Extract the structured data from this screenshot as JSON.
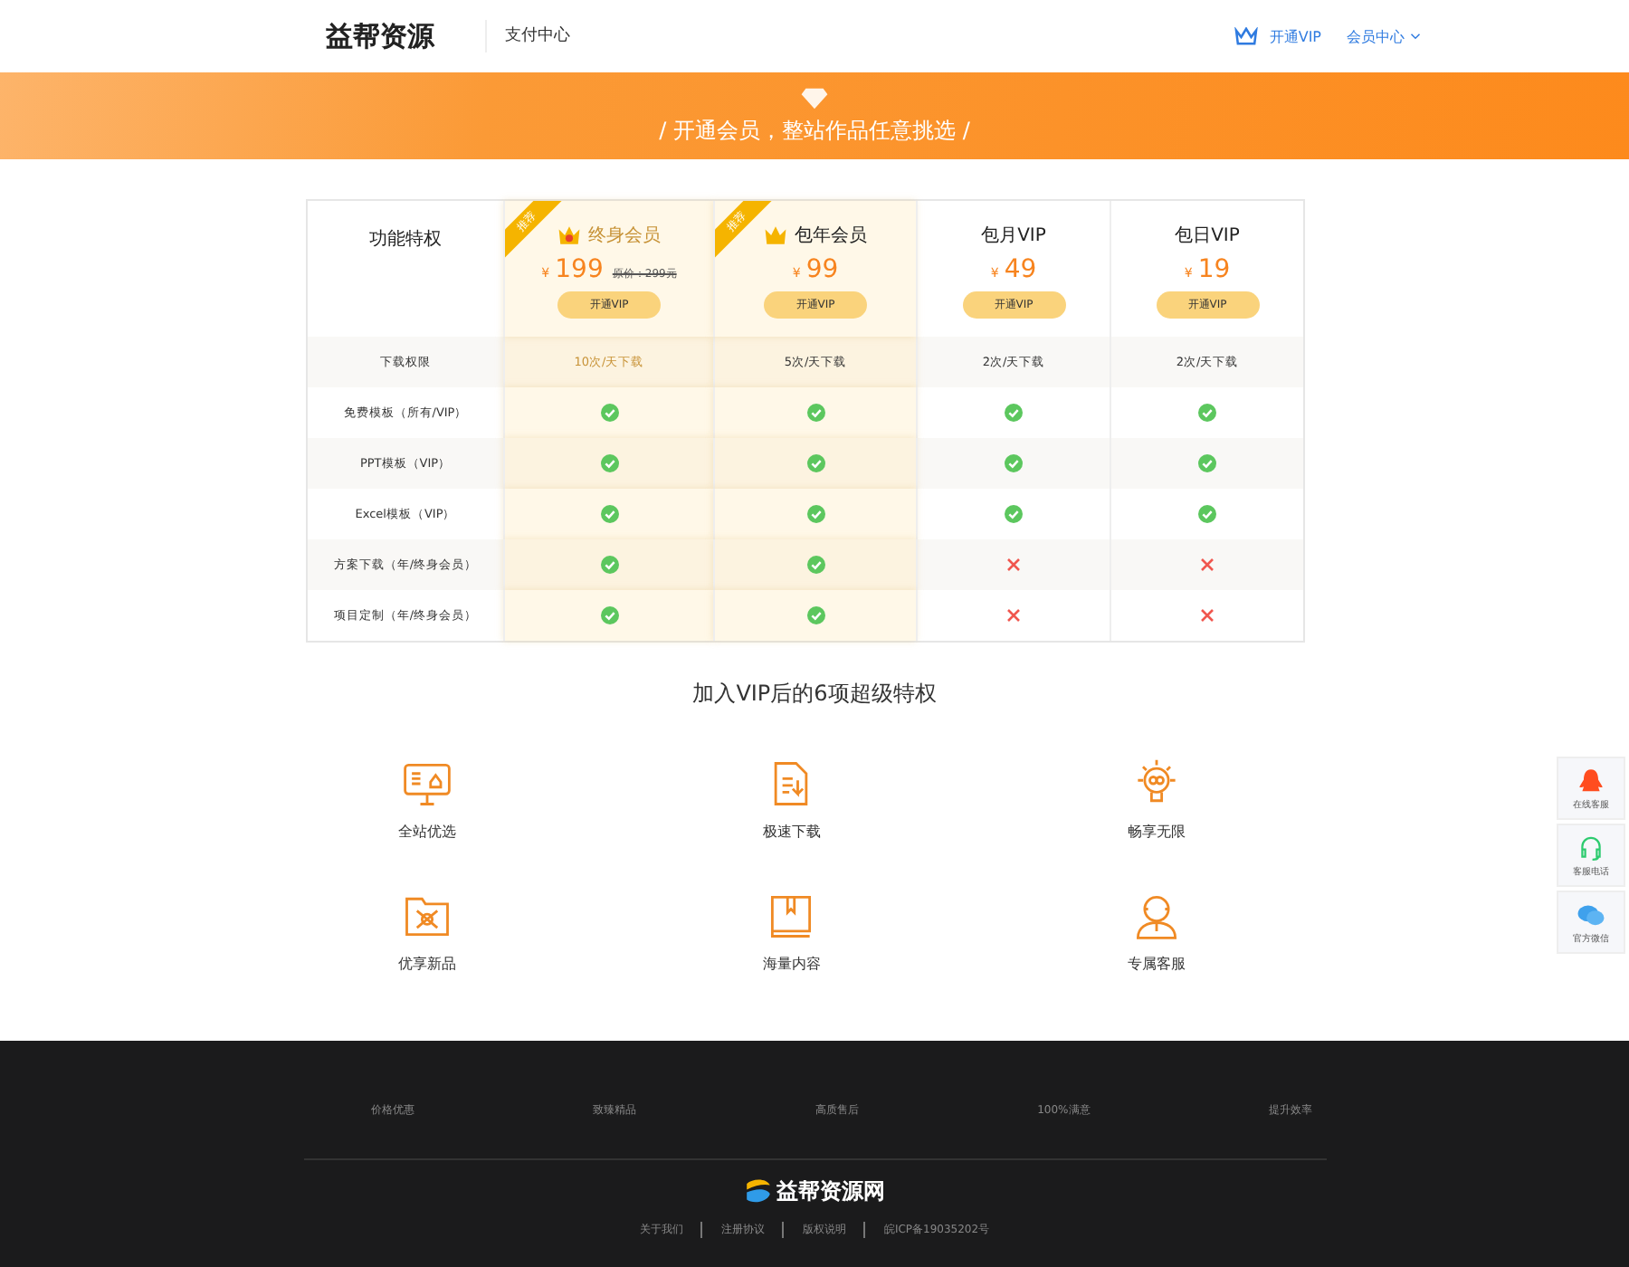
{
  "header": {
    "logo": "益帮资源",
    "section": "支付中心",
    "vip_link": "开通VIP",
    "member_menu": "会员中心"
  },
  "banner": {
    "slogan": "/ 开通会员，整站作品任意挑选 /"
  },
  "pricing": {
    "corner_label": "功能特权",
    "plans": [
      {
        "name": "终身会员",
        "currency": "¥",
        "price": "199",
        "old_price": "原价：299元",
        "button": "开通VIP",
        "badge": "推荐",
        "recommended": true,
        "selected": true
      },
      {
        "name": "包年会员",
        "currency": "¥",
        "price": "99",
        "button": "开通VIP",
        "badge": "推荐",
        "recommended": true,
        "selected": false
      },
      {
        "name": "包月VIP",
        "currency": "¥",
        "price": "49",
        "button": "开通VIP",
        "recommended": false,
        "selected": false
      },
      {
        "name": "包日VIP",
        "currency": "¥",
        "price": "19",
        "button": "开通VIP",
        "recommended": false,
        "selected": false
      }
    ],
    "rows": [
      {
        "label": "下载权限",
        "kind": "text",
        "cells": [
          "10次/天下载",
          "5次/天下载",
          "2次/天下载",
          "2次/天下载"
        ]
      },
      {
        "label": "免费模板（所有/VIP）",
        "kind": "mark",
        "cells": [
          true,
          true,
          true,
          true
        ]
      },
      {
        "label": "PPT模板（VIP）",
        "kind": "mark",
        "cells": [
          true,
          true,
          true,
          true
        ]
      },
      {
        "label": "Excel模板（VIP）",
        "kind": "mark",
        "cells": [
          true,
          true,
          true,
          true
        ]
      },
      {
        "label": "方案下载（年/终身会员）",
        "kind": "mark",
        "cells": [
          true,
          true,
          false,
          false
        ]
      },
      {
        "label": "项目定制（年/终身会员）",
        "kind": "mark",
        "cells": [
          true,
          true,
          false,
          false
        ]
      }
    ]
  },
  "privileges": {
    "title": "加入VIP后的6项超级特权",
    "items": [
      {
        "label": "全站优选"
      },
      {
        "label": "极速下载"
      },
      {
        "label": "畅享无限"
      },
      {
        "label": "优享新品"
      },
      {
        "label": "海量内容"
      },
      {
        "label": "专属客服"
      }
    ]
  },
  "side_bar": [
    {
      "label": "在线客服"
    },
    {
      "label": "客服电话"
    },
    {
      "label": "官方微信"
    }
  ],
  "footer": {
    "features": [
      "价格优惠",
      "致臻精品",
      "高质售后",
      "100%满意",
      "提升效率"
    ],
    "logo": "益帮资源网",
    "links": [
      "关于我们",
      "注册协议",
      "版权说明"
    ],
    "icp": "皖ICP备19035202号"
  }
}
